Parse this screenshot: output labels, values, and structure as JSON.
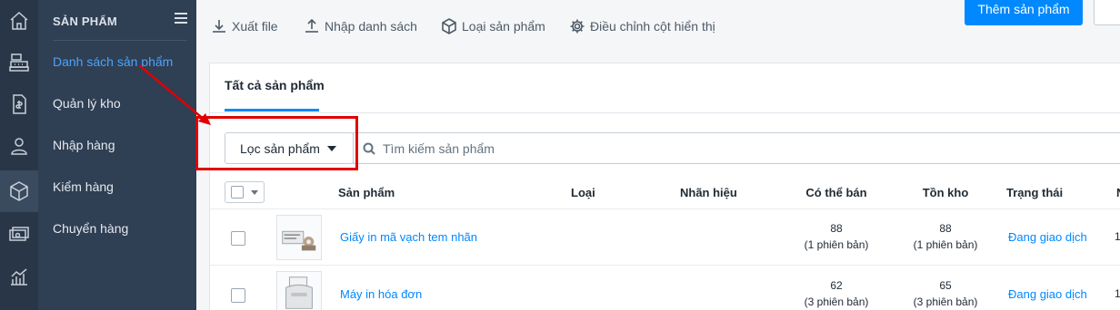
{
  "sidebar": {
    "title": "SẢN PHẨM",
    "items": [
      {
        "label": "Danh sách sản phẩm",
        "active": true
      },
      {
        "label": "Quản lý kho"
      },
      {
        "label": "Nhập hàng"
      },
      {
        "label": "Kiểm hàng"
      },
      {
        "label": "Chuyển hàng"
      }
    ]
  },
  "toolbar": {
    "export_label": "Xuất file",
    "import_label": "Nhập danh sách",
    "types_label": "Loại sản phẩm",
    "columns_label": "Điều chỉnh cột hiển thị",
    "add_label": "Thêm sản phẩm"
  },
  "tabs": {
    "all_label": "Tất cả sản phẩm"
  },
  "filter": {
    "button_label": "Lọc sản phẩm",
    "search_placeholder": "Tìm kiếm sản phẩm"
  },
  "table": {
    "headers": {
      "product": "Sản phẩm",
      "type": "Loại",
      "brand": "Nhãn hiệu",
      "available": "Có thể bán",
      "stock": "Tồn kho",
      "status": "Trạng thái",
      "extra": "N"
    },
    "rows": [
      {
        "name": "Giấy in mã vạch tem nhãn",
        "available": "88",
        "available_note": "(1 phiên bản)",
        "stock": "88",
        "stock_note": "(1 phiên bản)",
        "status": "Đang giao dịch",
        "trail": "1"
      },
      {
        "name": "Máy in hóa đơn",
        "available": "62",
        "available_note": "(3 phiên bản)",
        "stock": "65",
        "stock_note": "(3 phiên bản)",
        "status": "Đang giao dịch",
        "trail": "1"
      }
    ]
  },
  "colors": {
    "accent": "#0088ff",
    "sidebar_bg": "#2f3f54",
    "rail_bg": "#293647",
    "annotation": "#e00000"
  }
}
